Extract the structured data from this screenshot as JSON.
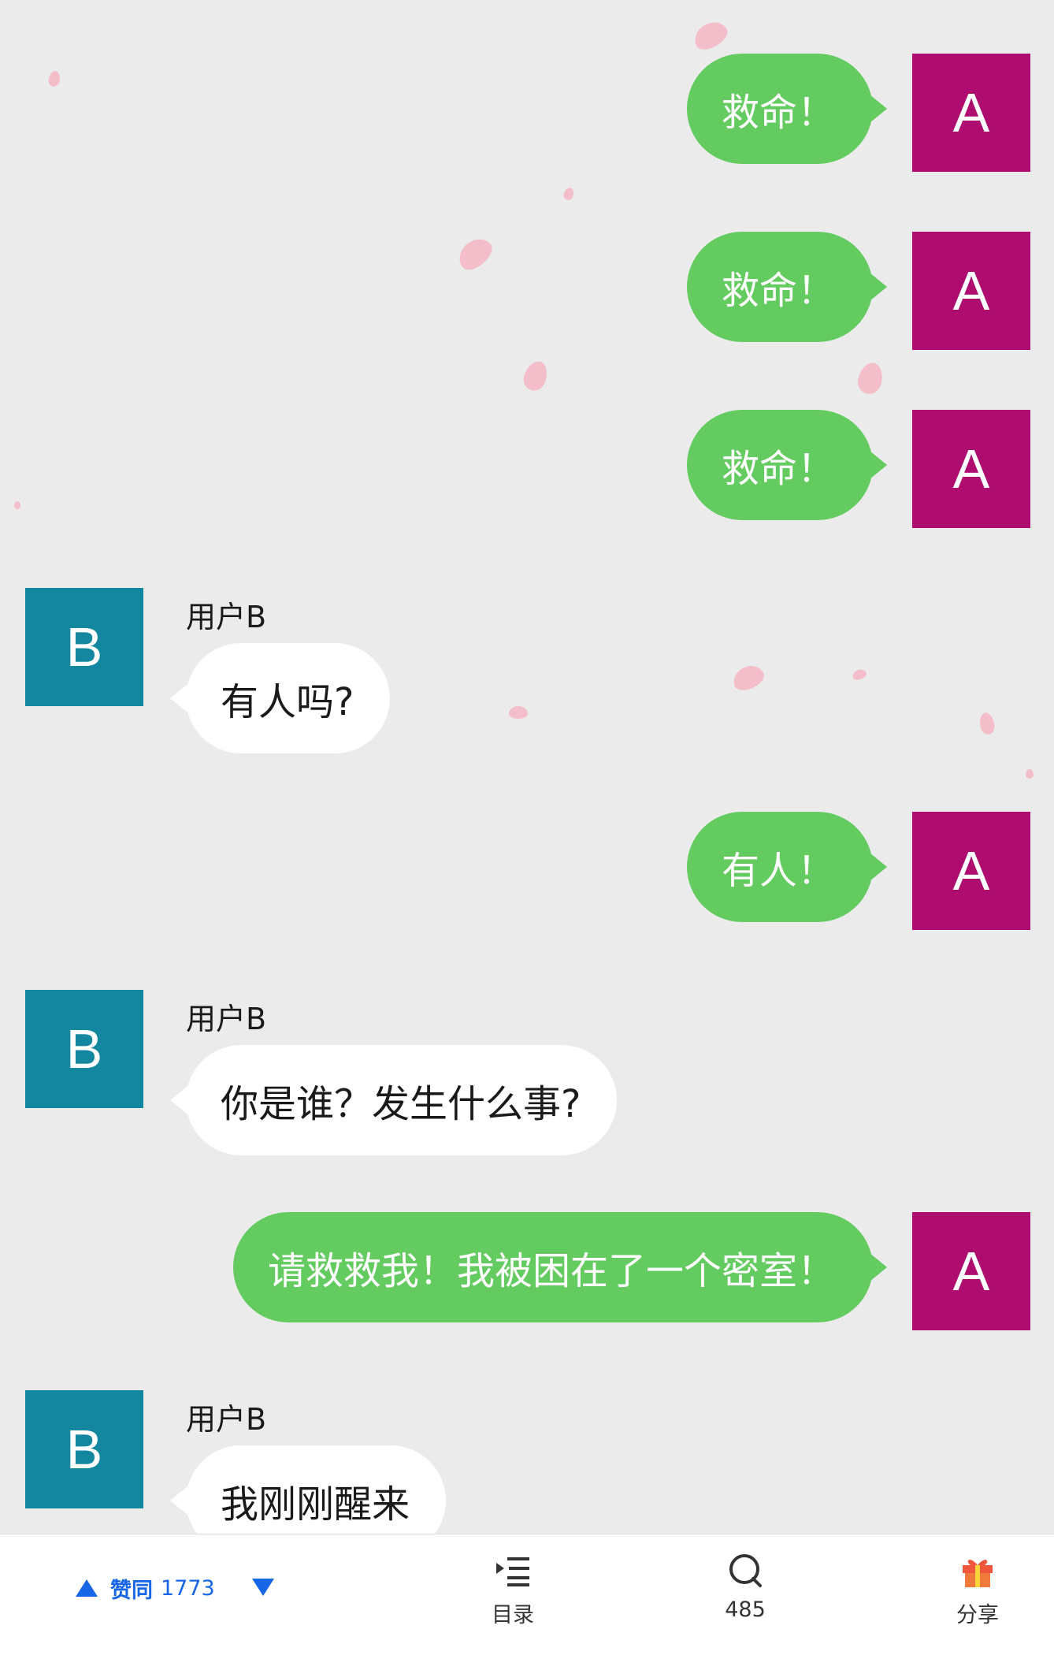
{
  "messages": [
    {
      "side": "right",
      "avatar": "A",
      "text": "救命！"
    },
    {
      "side": "right",
      "avatar": "A",
      "text": "救命！"
    },
    {
      "side": "right",
      "avatar": "A",
      "text": "救命！"
    },
    {
      "side": "left",
      "avatar": "B",
      "sender": "用户B",
      "text": "有人吗?"
    },
    {
      "side": "right",
      "avatar": "A",
      "text": "有人！"
    },
    {
      "side": "left",
      "avatar": "B",
      "sender": "用户B",
      "text": "你是谁？发生什么事?"
    },
    {
      "side": "right",
      "avatar": "A",
      "text": "请救救我！我被困在了一个密室！"
    },
    {
      "side": "left",
      "avatar": "B",
      "sender": "用户B",
      "text": "我刚刚醒来"
    }
  ],
  "bottom_bar": {
    "upvote_label": "赞同",
    "upvote_count": "1773",
    "catalog_label": "目录",
    "comment_count": "485",
    "share_label": "分享"
  },
  "colors": {
    "background": "#ebebeb",
    "green_bubble": "#63cb5f",
    "white_bubble": "#ffffff",
    "avatar_a": "#ae0d6f",
    "avatar_b": "#13879f",
    "accent_blue": "#1766e8",
    "petal": "#f5b8c6"
  },
  "icons": {
    "upvote": "triangle-up-icon",
    "downvote": "triangle-down-icon",
    "catalog": "list-icon",
    "comment": "comment-bubble-icon",
    "share": "gift-icon"
  }
}
